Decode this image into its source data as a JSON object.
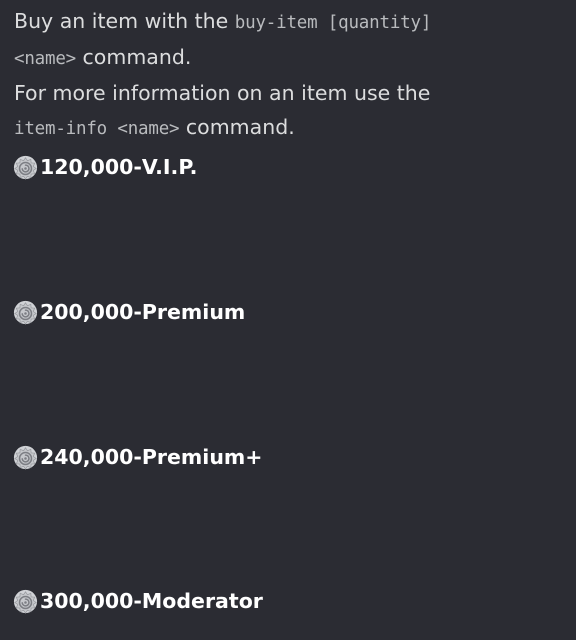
{
  "intro": {
    "line1_text": "Buy an item with the ",
    "line1_code": "buy-item [quantity]",
    "line2_code": "<name>",
    "line2_text": " command.",
    "line3_text": "For more information on an item use the",
    "line4_code": "item-info <name>",
    "line4_text": " command."
  },
  "items": [
    {
      "price": "120,000",
      "separator": " - ",
      "name": "V.I.P.",
      "icon": "coin-icon"
    },
    {
      "price": "200,000",
      "separator": " - ",
      "name": "Premium",
      "icon": "coin-icon"
    },
    {
      "price": "240,000",
      "separator": " - ",
      "name": "Premium+",
      "icon": "coin-icon"
    },
    {
      "price": "300,000",
      "separator": " - ",
      "name": "Moderator",
      "icon": "coin-icon"
    }
  ],
  "colors": {
    "background": "#2b2c33",
    "text": "#dcddde",
    "code_text": "#b9bbbe",
    "item_text": "#ffffff",
    "icon_fill": "#d0d2d6"
  }
}
